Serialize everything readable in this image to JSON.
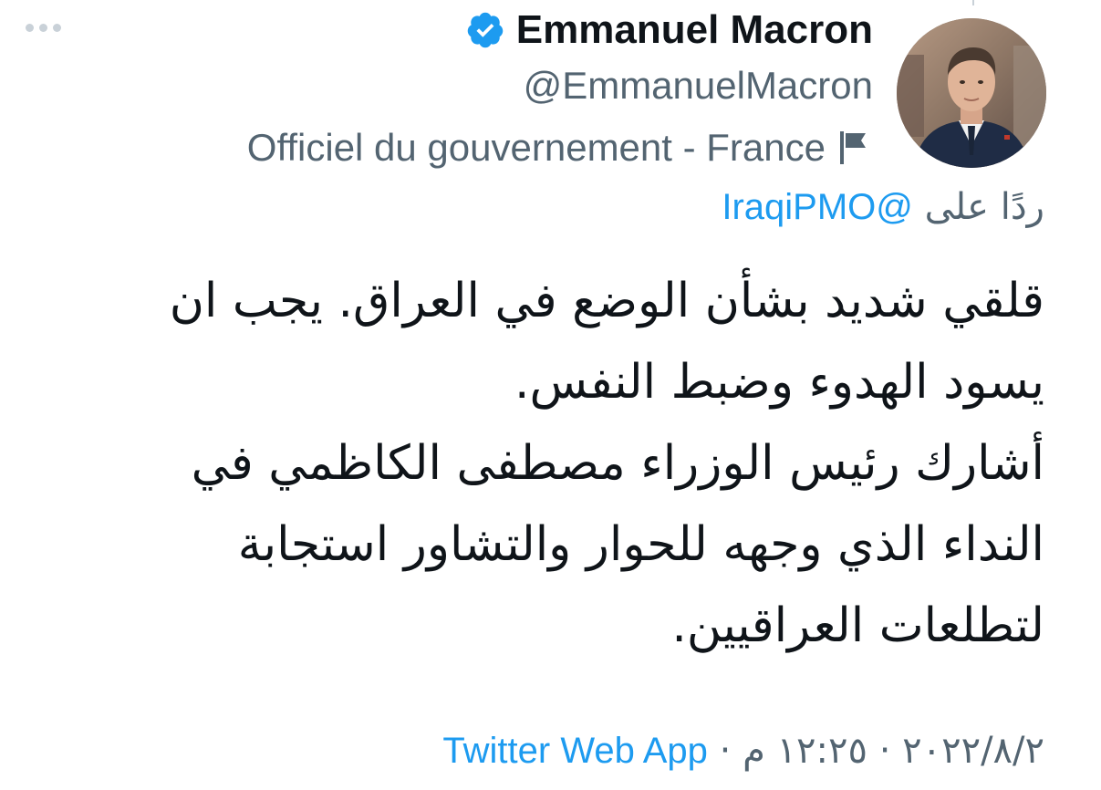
{
  "author": {
    "name": "Emmanuel Macron",
    "handle": "@EmmanuelMacron",
    "label": "Officiel du gouvernement - France",
    "verified_color": "#1d9bf0"
  },
  "reply": {
    "prefix": "ردًا على",
    "mention": "@IraqiPMO"
  },
  "tweet": {
    "lines": [
      "قلقي شديد بشأن الوضع في العراق. يجب ان",
      "يسود الهدوء وضبط النفس.",
      "أشارك رئيس الوزراء مصطفى الكاظمي في",
      "النداء الذي وجهه للحوار والتشاور استجابة",
      "لتطلعات العراقيين."
    ]
  },
  "meta": {
    "date": "٢٠٢٢/٨/٢",
    "separator": "·",
    "time": "١٢:٢٥ م",
    "source": "Twitter Web App"
  },
  "icons": {
    "more": "more-horizontal-icon",
    "verified": "verified-badge-icon",
    "flag": "government-flag-icon"
  },
  "colors": {
    "link": "#1d9bf0",
    "secondary_text": "#536471",
    "primary_text": "#0f1419"
  }
}
